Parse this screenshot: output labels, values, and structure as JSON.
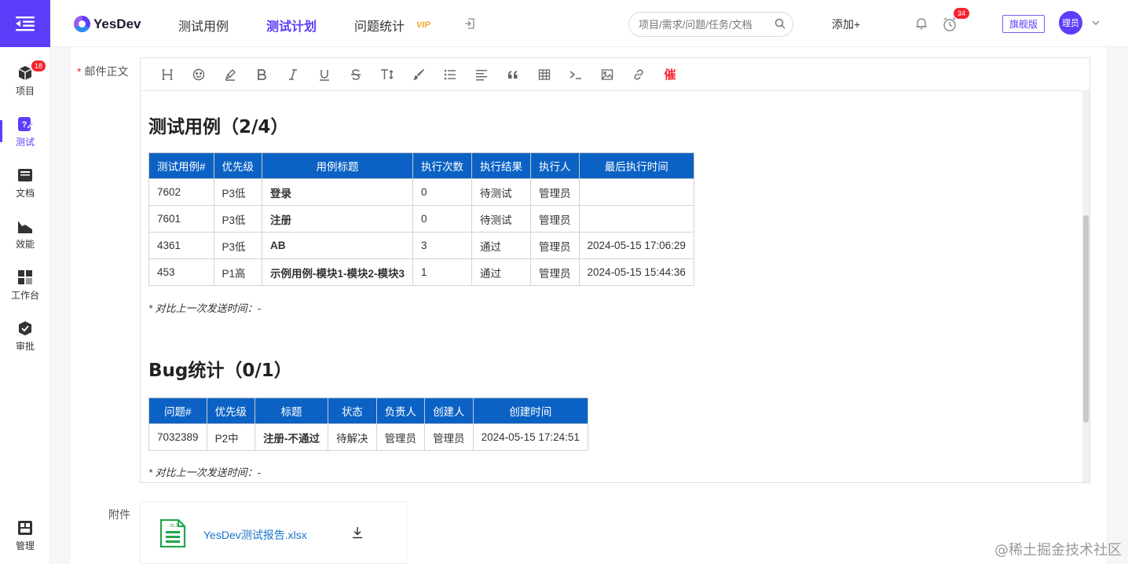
{
  "sidebar": {
    "items": [
      {
        "label": "项目",
        "badge": "18"
      },
      {
        "label": "测试",
        "badge": ""
      },
      {
        "label": "文档",
        "badge": ""
      },
      {
        "label": "效能",
        "badge": ""
      },
      {
        "label": "工作台",
        "badge": ""
      },
      {
        "label": "审批",
        "badge": ""
      }
    ],
    "bottom_label": "管理"
  },
  "header": {
    "logo_text": "YesDev",
    "tabs": [
      "测试用例",
      "测试计划",
      "问题统计"
    ],
    "vip": "VIP",
    "search_placeholder": "项目/需求/问题/任务/文档",
    "add_label": "添加+",
    "reminder_badge": "34",
    "edition": "旗舰版",
    "avatar_text": "理员"
  },
  "form": {
    "body_label": "邮件正文",
    "required_mark": "*",
    "attach_label": "附件"
  },
  "toolbar": {
    "urge_label": "催"
  },
  "report": {
    "test_title": "测试用例（2/4）",
    "test_headers": [
      "测试用例#",
      "优先级",
      "用例标题",
      "执行次数",
      "执行结果",
      "执行人",
      "最后执行时间"
    ],
    "test_rows": [
      [
        "7602",
        "P3低",
        "登录",
        "0",
        "待测试",
        "管理员",
        ""
      ],
      [
        "7601",
        "P3低",
        "注册",
        "0",
        "待测试",
        "管理员",
        ""
      ],
      [
        "4361",
        "P3低",
        "AB",
        "3",
        "通过",
        "管理员",
        "2024-05-15 17:06:29"
      ],
      [
        "453",
        "P1高",
        "示例用例-模块1-模块2-模块3",
        "1",
        "通过",
        "管理员",
        "2024-05-15 15:44:36"
      ]
    ],
    "test_note": "* 对比上一次发送时间：-",
    "bug_title": "Bug统计（0/1）",
    "bug_headers": [
      "问题#",
      "优先级",
      "标题",
      "状态",
      "负责人",
      "创建人",
      "创建时间"
    ],
    "bug_rows": [
      [
        "7032389",
        "P2中",
        "注册-不通过",
        "待解决",
        "管理员",
        "管理员",
        "2024-05-15 17:24:51"
      ]
    ],
    "bug_note": "* 对比上一次发送时间：-"
  },
  "attachment": {
    "file_icon_text": "XLS",
    "file_name": "YesDev测试报告.xlsx"
  },
  "watermark": "@稀土掘金技术社区",
  "colors": {
    "accent": "#5c3dfa",
    "table_header": "#0b62c4",
    "link": "#1a73c9",
    "priority_low": "#1bb6a6",
    "priority_high": "#f5a623",
    "badge": "#f5222d"
  }
}
